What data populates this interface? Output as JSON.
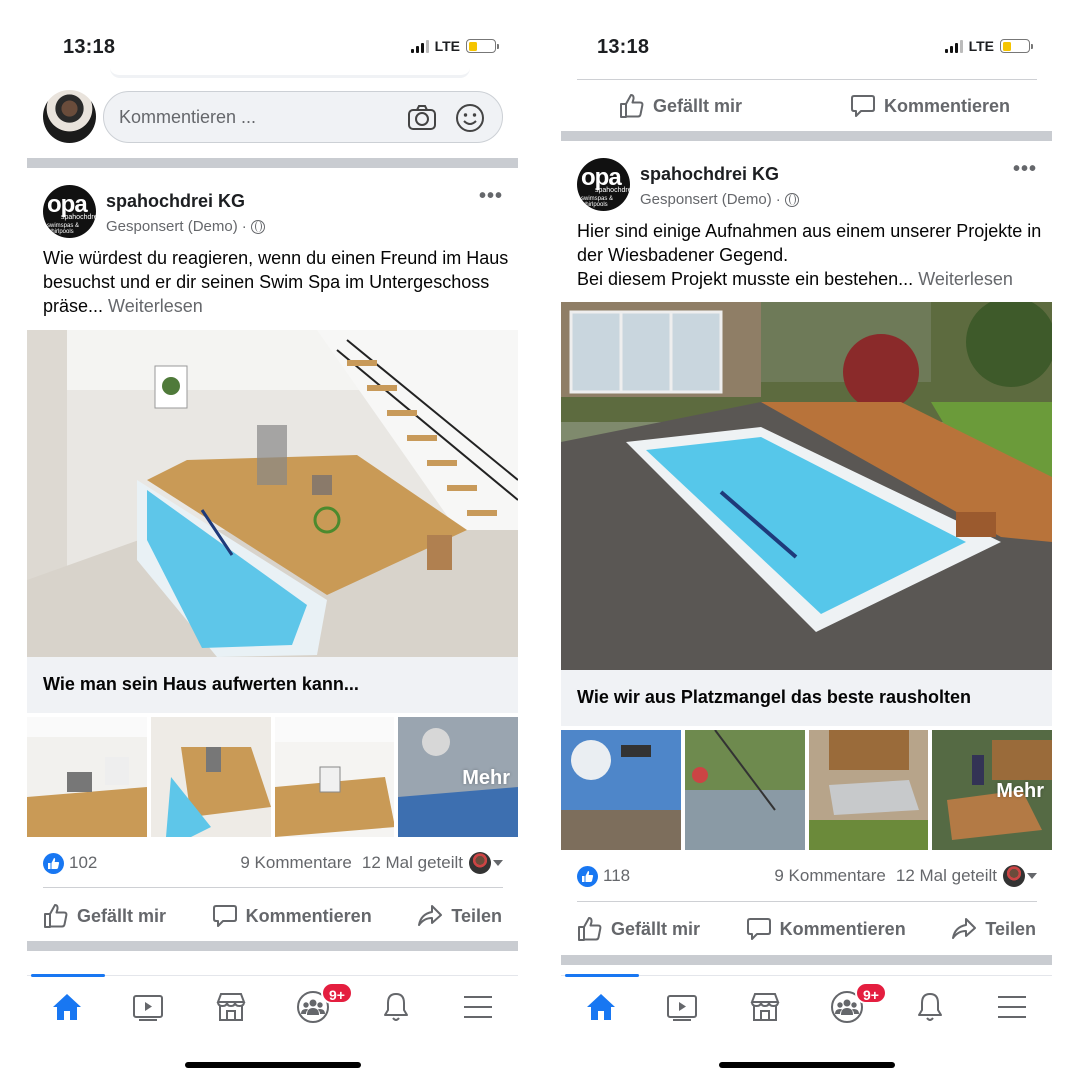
{
  "left": {
    "status": {
      "time": "13:18",
      "network": "LTE"
    },
    "comment_box": {
      "placeholder": "Kommentieren ..."
    },
    "post": {
      "author": "spahochdrei KG",
      "sponsored": "Gesponsert (Demo)",
      "dot": "·",
      "logo_text": {
        "main": "opa",
        "sub": "spahochdrei",
        "tagline": "swimspas & whirlpools"
      },
      "text": "Wie würdest du reagieren, wenn du einen Freund im Haus besuchst und er dir seinen Swim Spa im Untergeschoss präse...",
      "read_more": "Weiterlesen",
      "link_title": "Wie man sein Haus aufwerten kann...",
      "more_label": "Mehr",
      "reactions": {
        "count": "102",
        "comments": "9 Kommentare",
        "shares": "12 Mal geteilt"
      },
      "actions": {
        "like": "Gefällt mir",
        "comment": "Kommentieren",
        "share": "Teilen"
      }
    },
    "nav": {
      "badge": "9+"
    }
  },
  "right": {
    "status": {
      "time": "13:18",
      "network": "LTE"
    },
    "top_actions": {
      "like": "Gefällt mir",
      "comment": "Kommentieren"
    },
    "post": {
      "author": "spahochdrei KG",
      "sponsored": "Gesponsert (Demo)",
      "dot": "·",
      "logo_text": {
        "main": "opa",
        "sub": "spahochdrei",
        "tagline": "swimspas & whirlpools"
      },
      "text_line1": "Hier sind einige Aufnahmen aus einem unserer Projekte in der Wiesbadener Gegend.",
      "text_line2": "Bei diesem Projekt musste ein bestehen...",
      "read_more": "Weiterlesen",
      "link_title": "Wie wir aus Platzmangel das beste rausholten",
      "more_label": "Mehr",
      "reactions": {
        "count": "118",
        "comments": "9 Kommentare",
        "shares": "12 Mal geteilt"
      },
      "actions": {
        "like": "Gefällt mir",
        "comment": "Kommentieren",
        "share": "Teilen"
      }
    },
    "nav": {
      "badge": "9+"
    }
  },
  "colors": {
    "accent": "#1877f2",
    "badge": "#e41e3f",
    "divider": "#c9ccd1",
    "muted": "#65676b"
  },
  "icons": [
    "signal-icon",
    "battery-icon",
    "camera-icon",
    "emoji-icon",
    "globe-icon",
    "more-icon",
    "like-icon",
    "comment-icon",
    "share-icon",
    "home-icon",
    "video-icon",
    "marketplace-icon",
    "groups-icon",
    "bell-icon",
    "menu-icon"
  ]
}
